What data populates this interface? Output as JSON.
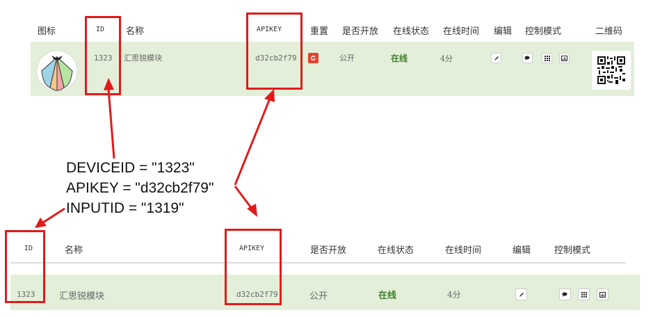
{
  "table1": {
    "headers": {
      "icon": "图标",
      "id": "ID",
      "name": "名称",
      "apikey": "APIKEY",
      "reset": "重置",
      "public": "是否开放",
      "status": "在线状态",
      "time": "在线时间",
      "edit": "编辑",
      "control": "控制模式",
      "qr": "二维码"
    },
    "row": {
      "id": "1323",
      "name": "汇思锐模块",
      "apikey": "d32cb2f79",
      "public": "公开",
      "status": "在线",
      "time": "4分"
    }
  },
  "annotation": {
    "deviceid": "DEVICEID = \"1323\"",
    "apikey": "APIKEY = \"d32cb2f79\"",
    "inputid": "INPUTID = \"1319\""
  },
  "table2": {
    "headers": {
      "id": "ID",
      "name": "名称",
      "apikey": "APIKEY",
      "public": "是否开放",
      "status": "在线状态",
      "time": "在线时间",
      "edit": "编辑",
      "control": "控制模式"
    },
    "row": {
      "id": "1323",
      "name": "汇思锐模块",
      "apikey": "d32cb2f79",
      "public": "公开",
      "status": "在线",
      "time": "4分"
    }
  },
  "colors": {
    "highlight": "#e21a1a",
    "row_bg": "#e3efd9",
    "online": "#3f7e2c",
    "reset_btn": "#e2432e"
  },
  "icons": [
    "shell-logo-icon",
    "refresh-icon",
    "pencil-icon",
    "chat-icon",
    "grid-icon",
    "chart-icon",
    "qr-code-icon"
  ]
}
